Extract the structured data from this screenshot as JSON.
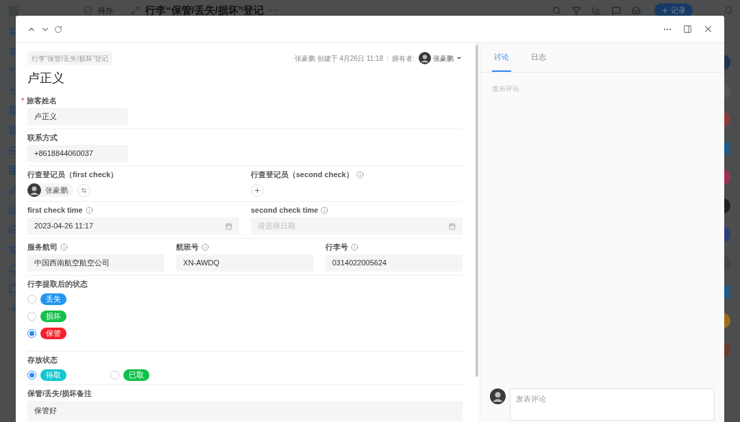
{
  "app": {
    "todo": "待办",
    "title": "行李“保管/丢失/损坏”登记",
    "title_more": "⋯",
    "add_button": "记录"
  },
  "dialog": {
    "breadcrumb": "行李“保管/丢失/损坏”登记",
    "created": "张豪鹏 创建于 4月26日 11:18",
    "owner_label": "拥有者:",
    "owner": "张豪鹏",
    "title": "卢正义",
    "rows": [
      {
        "fields": [
          {
            "kind": "text",
            "label": "旅客姓名",
            "required_mark": "*",
            "info": false,
            "value": "卢正义"
          }
        ]
      },
      {
        "fields": [
          {
            "kind": "text",
            "label": "联系方式",
            "info": false,
            "value": "+8618844060037"
          }
        ]
      },
      {
        "fields": [
          {
            "kind": "members",
            "label": "行查登记员（first check）",
            "info": false,
            "members": [
              "张豪鹏"
            ]
          },
          {
            "kind": "members",
            "label": "行查登记员（second check）",
            "info": true
          }
        ]
      },
      {
        "fields": [
          {
            "kind": "date",
            "label": "first check time",
            "info": true,
            "value": "2023-04-26 11:17"
          },
          {
            "kind": "date",
            "label": "second check time",
            "info": true,
            "placeholder": "请选择日期"
          }
        ]
      },
      {
        "fields": [
          {
            "kind": "text",
            "label": "服务航司",
            "info": true,
            "value": "中国西南航空航空公司"
          },
          {
            "kind": "text",
            "label": "航班号",
            "info": true,
            "value": "XN-AWDQ"
          },
          {
            "kind": "text",
            "label": "行李号",
            "info": true,
            "value": "0314022005624"
          }
        ]
      },
      {
        "fields": [
          {
            "kind": "radio-list",
            "label": "行李提取后的状态",
            "info": false,
            "options": [
              {
                "label": "丢失",
                "color": "#2196f3",
                "selected": false
              },
              {
                "label": "损坏",
                "color": "#13c04a",
                "selected": false
              },
              {
                "label": "保管",
                "color": "#f5222d",
                "selected": true
              }
            ]
          }
        ]
      },
      {
        "fields": [
          {
            "kind": "radio-row",
            "label": "存放状态",
            "info": false,
            "options": [
              {
                "label": "待取",
                "color": "#12c7cf",
                "selected": true
              },
              {
                "label": "已取",
                "color": "#13c04a",
                "selected": false
              }
            ]
          }
        ]
      },
      {
        "fields": [
          {
            "kind": "textarea",
            "label": "保管/丢失/损坏备注",
            "info": false,
            "value": "保管好"
          }
        ]
      }
    ]
  },
  "side": {
    "tabs": [
      {
        "label": "讨论",
        "selected": true
      },
      {
        "label": "日志",
        "selected": false
      }
    ],
    "empty": "发布评论",
    "comment_placeholder": "发表评论"
  }
}
